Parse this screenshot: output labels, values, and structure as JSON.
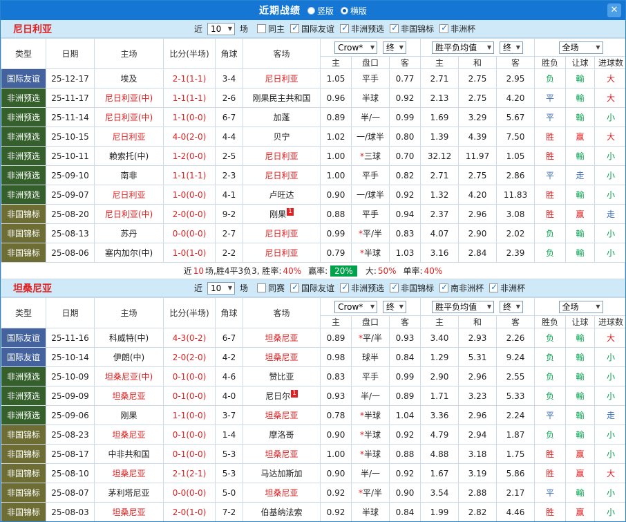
{
  "titlebar": {
    "title": "近期战绩",
    "radios": [
      {
        "label": "竖版",
        "selected": false
      },
      {
        "label": "横版",
        "selected": true
      }
    ],
    "close": "✕"
  },
  "table_head": {
    "type": "类型",
    "date": "日期",
    "home": "主场",
    "score": "比分(半场)",
    "corners": "角球",
    "away": "客场",
    "h_home": "主",
    "handicap": "盘口",
    "h_away": "客",
    "o_home": "主",
    "o_draw": "和",
    "o_away": "客",
    "result": "胜负",
    "let": "让球",
    "goals": "进球数",
    "dd_company": "Crow*",
    "dd_final": "终",
    "dd_avg": "胜平负均值",
    "dd_scope": "全场"
  },
  "colors": {
    "win": "#e02020",
    "draw": "#3a6ebf",
    "lose": "#00a14b",
    "type_friendly": "#44639e",
    "type_qualifier": "#35602c",
    "type_championship": "#6d6d34"
  },
  "sections": [
    {
      "team": "尼日利亚",
      "filters": {
        "near": "近",
        "count": "10",
        "unit": "场",
        "checks": [
          {
            "label": "同主",
            "checked": false
          },
          {
            "label": "国际友谊",
            "checked": true
          },
          {
            "label": "非洲预选",
            "checked": true
          },
          {
            "label": "非国锦标",
            "checked": true
          },
          {
            "label": "非洲杯",
            "checked": true
          }
        ]
      },
      "rows": [
        {
          "type": "国际友谊",
          "date": "25-12-17",
          "home": "埃及",
          "score": "2-1(1-1)",
          "corners": "3-4",
          "away": "尼日利亚",
          "away_focus": true,
          "h_home": "1.05",
          "handicap": "平手",
          "h_away": "0.77",
          "o_home": "2.71",
          "o_draw": "2.75",
          "o_away": "2.95",
          "result": "负",
          "let": "輸",
          "goals": "大"
        },
        {
          "type": "非洲预选",
          "date": "25-11-17",
          "home": "尼日利亚(中)",
          "home_focus": true,
          "score": "1-1(1-1)",
          "corners": "2-6",
          "away": "刚果民主共和国",
          "h_home": "0.96",
          "handicap": "半球",
          "h_away": "0.92",
          "o_home": "2.13",
          "o_draw": "2.75",
          "o_away": "4.20",
          "result": "平",
          "let": "輸",
          "goals": "大"
        },
        {
          "type": "非洲预选",
          "date": "25-11-14",
          "home": "尼日利亚(中)",
          "home_focus": true,
          "score": "1-1(0-0)",
          "corners": "6-7",
          "away": "加蓬",
          "h_home": "0.89",
          "handicap": "半/一",
          "h_away": "0.99",
          "o_home": "1.69",
          "o_draw": "3.29",
          "o_away": "5.67",
          "result": "平",
          "let": "輸",
          "goals": "小"
        },
        {
          "type": "非洲预选",
          "date": "25-10-15",
          "home": "尼日利亚",
          "home_focus": true,
          "score": "4-0(2-0)",
          "corners": "4-4",
          "away": "贝宁",
          "h_home": "1.02",
          "handicap": "一/球半",
          "h_away": "0.80",
          "o_home": "1.39",
          "o_draw": "4.39",
          "o_away": "7.50",
          "result": "胜",
          "let": "赢",
          "goals": "大"
        },
        {
          "type": "非洲预选",
          "date": "25-10-11",
          "home": "赖索托(中)",
          "score": "1-2(0-0)",
          "corners": "2-5",
          "away": "尼日利亚",
          "away_focus": true,
          "h_home": "1.00",
          "handicap": "*三球",
          "h_away": "0.70",
          "o_home": "32.12",
          "o_draw": "11.97",
          "o_away": "1.05",
          "result": "胜",
          "let": "輸",
          "goals": "小"
        },
        {
          "type": "非洲预选",
          "date": "25-09-10",
          "home": "南非",
          "score": "1-1(1-1)",
          "corners": "2-3",
          "away": "尼日利亚",
          "away_focus": true,
          "h_home": "1.00",
          "handicap": "平手",
          "h_away": "0.82",
          "o_home": "2.71",
          "o_draw": "2.75",
          "o_away": "2.86",
          "result": "平",
          "let": "走",
          "goals": "小"
        },
        {
          "type": "非洲预选",
          "date": "25-09-07",
          "home": "尼日利亚",
          "home_focus": true,
          "score": "1-0(0-0)",
          "corners": "4-1",
          "away": "卢旺达",
          "h_home": "0.90",
          "handicap": "一/球半",
          "h_away": "0.92",
          "o_home": "1.32",
          "o_draw": "4.20",
          "o_away": "11.83",
          "result": "胜",
          "let": "輸",
          "goals": "小"
        },
        {
          "type": "非国锦标",
          "date": "25-08-20",
          "home": "尼日利亚(中)",
          "home_focus": true,
          "score": "2-0(0-0)",
          "corners": "9-2",
          "away": "刚果",
          "away_badge": "1",
          "h_home": "0.88",
          "handicap": "平手",
          "h_away": "0.94",
          "o_home": "2.37",
          "o_draw": "2.96",
          "o_away": "3.08",
          "result": "胜",
          "let": "赢",
          "goals": "走"
        },
        {
          "type": "非国锦标",
          "date": "25-08-13",
          "home": "苏丹",
          "score": "0-0(0-0)",
          "corners": "2-7",
          "away": "尼日利亚",
          "away_focus": true,
          "h_home": "0.99",
          "handicap": "*平/半",
          "h_away": "0.83",
          "o_home": "4.07",
          "o_draw": "2.90",
          "o_away": "2.02",
          "result": "负",
          "let": "輸",
          "goals": "小"
        },
        {
          "type": "非国锦标",
          "date": "25-08-06",
          "home": "塞内加尔(中)",
          "score": "1-0(1-0)",
          "corners": "2-2",
          "away": "尼日利亚",
          "away_focus": true,
          "h_home": "0.79",
          "handicap": "*半球",
          "h_away": "1.03",
          "o_home": "3.16",
          "o_draw": "2.84",
          "o_away": "2.39",
          "result": "负",
          "let": "輸",
          "goals": "小"
        }
      ],
      "summary": {
        "seg1": "近",
        "count": "10",
        "seg2": "场,胜4平3负3, 胜率:",
        "win": "40%",
        "seg3": "赢率:",
        "badge": "20%",
        "seg4": "大:",
        "big": "50%",
        "seg5": "单率:",
        "odd": "40%"
      }
    },
    {
      "team": "坦桑尼亚",
      "filters": {
        "near": "近",
        "count": "10",
        "unit": "场",
        "checks": [
          {
            "label": "同赛",
            "checked": false
          },
          {
            "label": "国际友谊",
            "checked": true
          },
          {
            "label": "非洲预选",
            "checked": true
          },
          {
            "label": "非国锦标",
            "checked": true
          },
          {
            "label": "南非洲杯",
            "checked": true
          },
          {
            "label": "非洲杯",
            "checked": true
          }
        ]
      },
      "rows": [
        {
          "type": "国际友谊",
          "date": "25-11-16",
          "home": "科威特(中)",
          "score": "4-3(0-2)",
          "corners": "6-7",
          "away": "坦桑尼亚",
          "away_focus": true,
          "h_home": "0.89",
          "handicap": "*平/半",
          "h_away": "0.93",
          "o_home": "3.40",
          "o_draw": "2.93",
          "o_away": "2.26",
          "result": "负",
          "let": "輸",
          "goals": "大"
        },
        {
          "type": "国际友谊",
          "date": "25-10-14",
          "home": "伊朗(中)",
          "score": "2-0(2-0)",
          "corners": "4-2",
          "away": "坦桑尼亚",
          "away_focus": true,
          "h_home": "0.98",
          "handicap": "球半",
          "h_away": "0.84",
          "o_home": "1.29",
          "o_draw": "5.31",
          "o_away": "9.24",
          "result": "负",
          "let": "輸",
          "goals": "小"
        },
        {
          "type": "非洲预选",
          "date": "25-10-09",
          "home": "坦桑尼亚(中)",
          "home_focus": true,
          "score": "0-1(0-0)",
          "corners": "4-6",
          "away": "赞比亚",
          "h_home": "0.83",
          "handicap": "平手",
          "h_away": "0.99",
          "o_home": "2.90",
          "o_draw": "2.96",
          "o_away": "2.55",
          "result": "负",
          "let": "輸",
          "goals": "小"
        },
        {
          "type": "非洲预选",
          "date": "25-09-09",
          "home": "坦桑尼亚",
          "home_focus": true,
          "score": "0-1(0-0)",
          "corners": "4-0",
          "away": "尼日尔",
          "away_badge": "1",
          "h_home": "0.93",
          "handicap": "半/一",
          "h_away": "0.89",
          "o_home": "1.71",
          "o_draw": "3.23",
          "o_away": "5.33",
          "result": "负",
          "let": "輸",
          "goals": "小"
        },
        {
          "type": "非洲预选",
          "date": "25-09-06",
          "home": "刚果",
          "score": "1-1(0-0)",
          "corners": "3-7",
          "away": "坦桑尼亚",
          "away_focus": true,
          "h_home": "0.78",
          "handicap": "*半球",
          "h_away": "1.04",
          "o_home": "3.36",
          "o_draw": "2.96",
          "o_away": "2.24",
          "result": "平",
          "let": "輸",
          "goals": "走"
        },
        {
          "type": "非国锦标",
          "date": "25-08-23",
          "home": "坦桑尼亚",
          "home_focus": true,
          "score": "0-1(0-0)",
          "corners": "1-4",
          "away": "摩洛哥",
          "h_home": "0.90",
          "handicap": "*半球",
          "h_away": "0.92",
          "o_home": "4.79",
          "o_draw": "2.94",
          "o_away": "1.87",
          "result": "负",
          "let": "輸",
          "goals": "小"
        },
        {
          "type": "非国锦标",
          "date": "25-08-17",
          "home": "中非共和国",
          "score": "0-1(0-0)",
          "corners": "5-3",
          "away": "坦桑尼亚",
          "away_focus": true,
          "h_home": "1.00",
          "handicap": "*半球",
          "h_away": "0.88",
          "o_home": "4.88",
          "o_draw": "3.18",
          "o_away": "1.75",
          "result": "胜",
          "let": "赢",
          "goals": "小"
        },
        {
          "type": "非国锦标",
          "date": "25-08-10",
          "home": "坦桑尼亚",
          "home_focus": true,
          "score": "2-1(2-1)",
          "corners": "5-3",
          "away": "马达加斯加",
          "h_home": "0.90",
          "handicap": "半/一",
          "h_away": "0.92",
          "o_home": "1.67",
          "o_draw": "3.19",
          "o_away": "5.86",
          "result": "胜",
          "let": "赢",
          "goals": "大"
        },
        {
          "type": "非国锦标",
          "date": "25-08-07",
          "home": "茅利塔尼亚",
          "score": "0-0(0-0)",
          "corners": "5-0",
          "away": "坦桑尼亚",
          "away_focus": true,
          "h_home": "0.92",
          "handicap": "*平/半",
          "h_away": "0.90",
          "o_home": "3.54",
          "o_draw": "2.88",
          "o_away": "2.17",
          "result": "平",
          "let": "輸",
          "goals": "小"
        },
        {
          "type": "非国锦标",
          "date": "25-08-03",
          "home": "坦桑尼亚",
          "home_focus": true,
          "score": "2-0(1-0)",
          "corners": "7-2",
          "away": "伯基纳法索",
          "h_home": "0.92",
          "handicap": "半球",
          "h_away": "0.84",
          "o_home": "1.99",
          "o_draw": "2.82",
          "o_away": "4.46",
          "result": "胜",
          "let": "赢",
          "goals": "小"
        }
      ],
      "summary": null
    }
  ]
}
